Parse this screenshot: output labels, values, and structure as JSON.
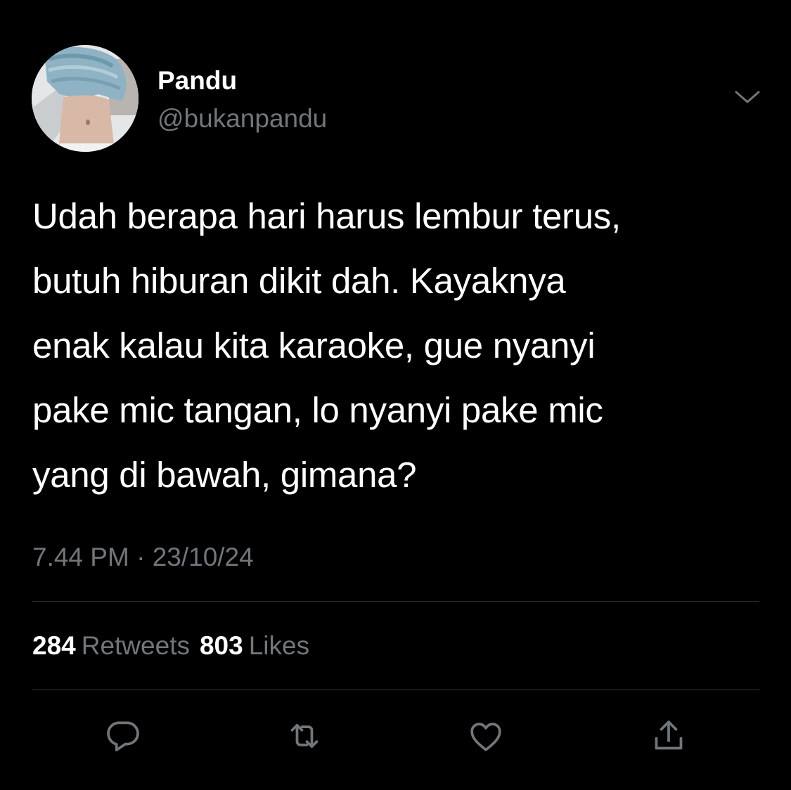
{
  "author": {
    "display_name": "Pandu",
    "handle": "@bukanpandu",
    "avatar_icon": "avatar-photo"
  },
  "tweet": {
    "text_lines": [
      "Udah berapa hari harus lembur terus,",
      "butuh hiburan dikit dah. Kayaknya",
      "enak kalau kita karaoke, gue nyanyi",
      "pake mic tangan, lo nyanyi pake mic",
      "yang di bawah, gimana?"
    ],
    "time": "7.44 PM",
    "separator": "·",
    "date": "23/10/24"
  },
  "stats": {
    "retweets_count": "284",
    "retweets_label": "Retweets",
    "likes_count": "803",
    "likes_label": "Likes"
  },
  "actions": [
    {
      "icon": "reply-icon"
    },
    {
      "icon": "retweet-icon"
    },
    {
      "icon": "like-icon"
    },
    {
      "icon": "share-icon"
    }
  ],
  "colors": {
    "background": "#000000",
    "primary_text": "#ffffff",
    "secondary_text": "#71767b",
    "divider": "#2f3336"
  }
}
